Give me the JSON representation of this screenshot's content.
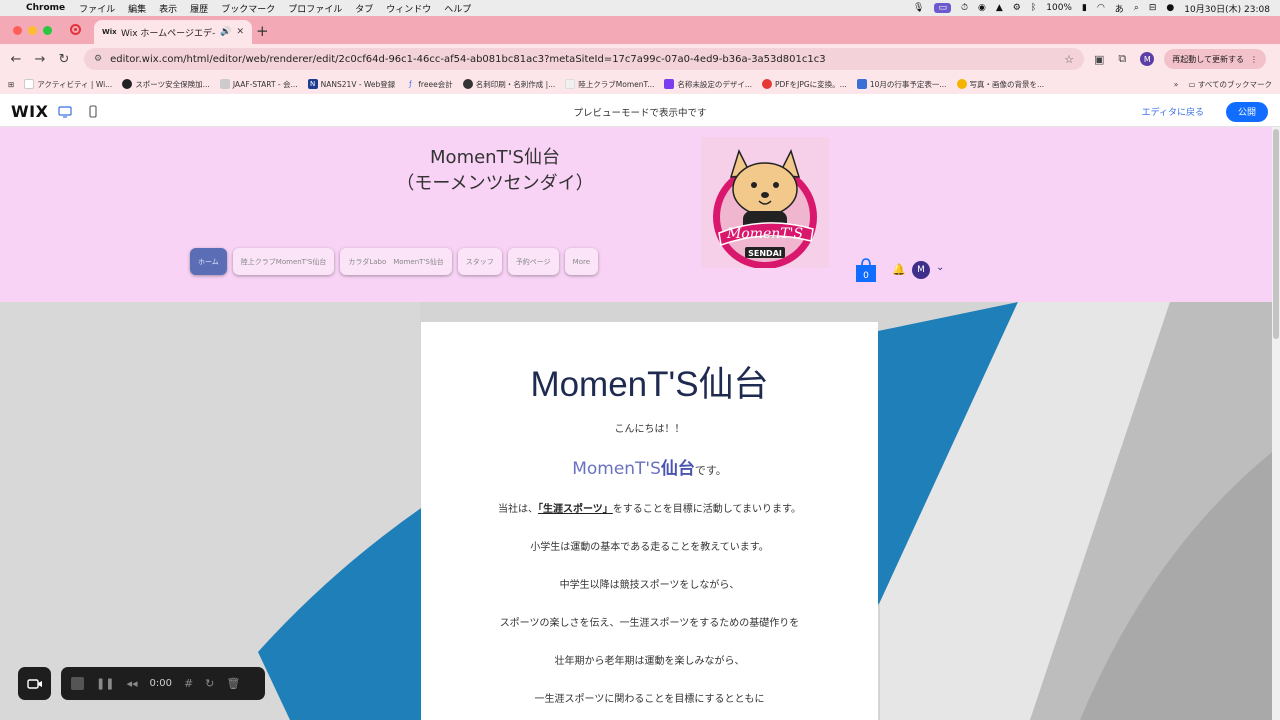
{
  "menubar": {
    "app": "Chrome",
    "items": [
      "ファイル",
      "編集",
      "表示",
      "履歴",
      "ブックマーク",
      "プロファイル",
      "タブ",
      "ウィンドウ",
      "ヘルプ"
    ],
    "battery": "100%",
    "clock": "10月30日(木) 23:08"
  },
  "browser": {
    "tab_title": "Wix ホームページエディタ",
    "url": "editor.wix.com/html/editor/web/renderer/edit/2c0cf64d-96c1-46cc-af54-ab081bc81ac3?metaSiteId=17c7a99c-07a0-4ed9-b36a-3a53d801c1c3",
    "profile_initial": "M",
    "relaunch_label": "再起動して更新する",
    "bookmarks": [
      "アクティビティ | Wi...",
      "スポーツ安全保険加...",
      "JAAF-START - 会...",
      "NANS21V - Web登録",
      "freee会計",
      "名刺印刷・名刺作成 |...",
      "陸上クラブMomenT...",
      "名称未設定のデザイ...",
      "PDFをJPGに変換。...",
      "10月の行事予定表一...",
      "写真・画像の背景を..."
    ],
    "bookmarks_more": "»",
    "all_bookmarks": "すべてのブックマーク"
  },
  "wix": {
    "logo": "WIX",
    "mode_text": "プレビューモードで表示中です",
    "back_to_editor": "エディタに戻る",
    "publish": "公開"
  },
  "site": {
    "title_line1": "MomenT'S仙台",
    "title_line2": "（モーメンツセンダイ）",
    "logo_text": "MomenT'S",
    "logo_sub": "SENDAI",
    "menu": [
      "ホーム",
      "陸上クラブMomenT'S仙台",
      "カラダLabo　MomenT'S仙台",
      "スタッフ",
      "予約ページ",
      "More"
    ],
    "cart_count": "0",
    "member_initial": "M"
  },
  "card": {
    "title": "MomenT'S仙台",
    "greeting": "こんにちは！！",
    "sub_prefix": "MomenT'S",
    "sub_bold": "仙台",
    "sub_suffix": "です。",
    "intro_prefix": "当社は、",
    "intro_bold": "「生涯スポーツ」",
    "intro_suffix": "をすることを目標に活動してまいります。",
    "lines": [
      "小学生は運動の基本である走ることを教えています。",
      "中学生以降は競技スポーツをしながら、",
      "スポーツの楽しさを伝え、一生涯スポーツをするための基礎作りを",
      "壮年期から老年期は運動を楽しみながら、",
      "一生涯スポーツに関わることを目標にするとともに"
    ]
  },
  "recorder": {
    "time": "0:00"
  },
  "colors": {
    "tab_bar": "#f3a9b6",
    "header_bg": "#f8d3f5",
    "accent_blue": "#116dff",
    "title_navy": "#1e2a4f"
  }
}
